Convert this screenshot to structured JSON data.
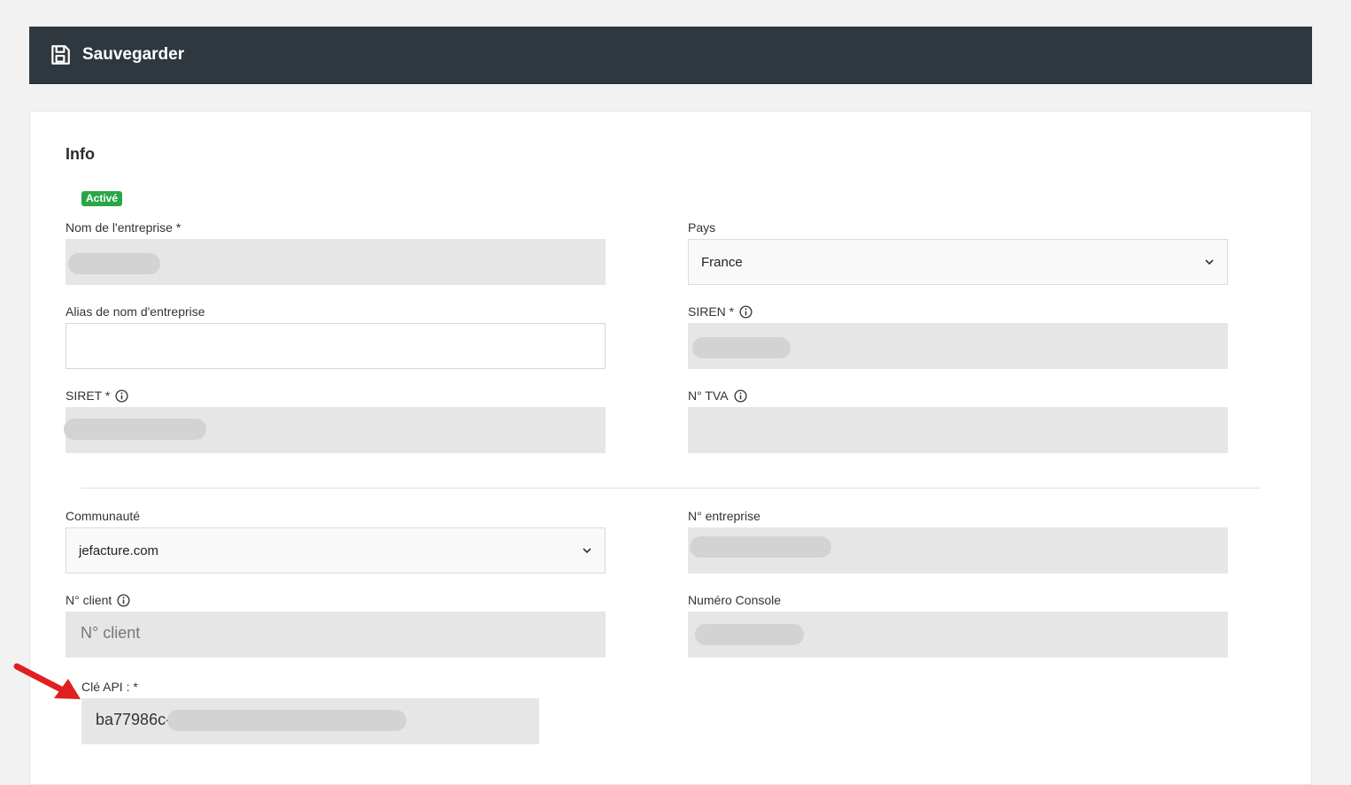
{
  "toolbar": {
    "save_label": "Sauvegarder",
    "save_icon": "floppy-disk-icon"
  },
  "section": {
    "title": "Info",
    "status_badge": "Activé",
    "status_color": "#28a745"
  },
  "fields": {
    "company_name": {
      "label": "Nom de l'entreprise *"
    },
    "country": {
      "label": "Pays",
      "value": "France"
    },
    "company_alias": {
      "label": "Alias de nom d'entreprise",
      "value": ""
    },
    "siren": {
      "label": "SIREN *"
    },
    "siret": {
      "label": "SIRET *"
    },
    "vat": {
      "label": "N° TVA"
    },
    "community": {
      "label": "Communauté",
      "value": "jefacture.com"
    },
    "company_number": {
      "label": "N° entreprise"
    },
    "client_number": {
      "label": "N° client",
      "placeholder": "N° client"
    },
    "console_number": {
      "label": "Numéro Console"
    },
    "api_key": {
      "label": "Clé API : *",
      "value": "ba77986c-"
    }
  },
  "colors": {
    "topbar": "#30383f",
    "annotation_arrow": "#e02020"
  }
}
